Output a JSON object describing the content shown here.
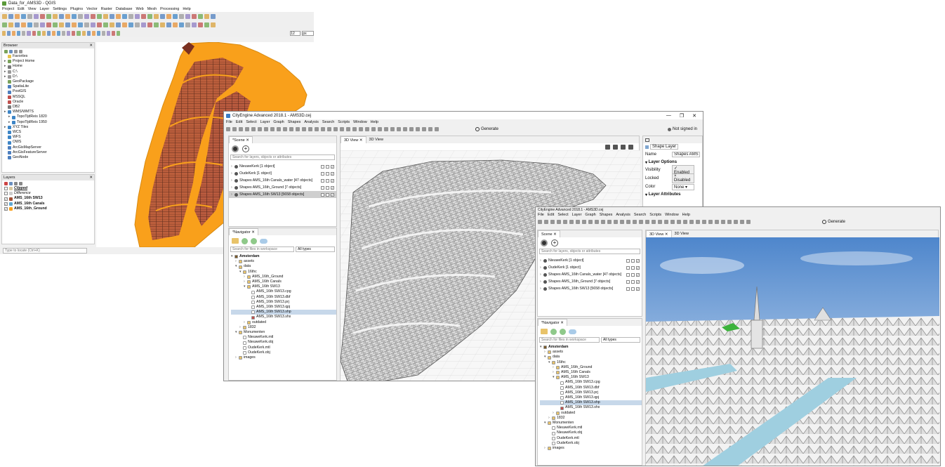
{
  "qgis": {
    "title": "Data_for_AMS3D - QGIS",
    "menu": [
      "Project",
      "Edit",
      "View",
      "Layer",
      "Settings",
      "Plugins",
      "Vector",
      "Raster",
      "Database",
      "Web",
      "Mesh",
      "Processing",
      "Help"
    ],
    "scale_value": "12",
    "unit_value": "px",
    "browser": {
      "title": "Browser",
      "items": [
        "Favorites",
        "Project Home",
        "Home",
        "C:\\",
        "D:\\",
        "GeoPackage",
        "SpatiaLite",
        "PostGIS",
        "MSSQL",
        "Oracle",
        "DB2",
        "WMS/WMTS",
        "TopoTijdReis 1820",
        "TopoTijdReis 1950",
        "XYZ Tiles",
        "WCS",
        "WFS",
        "OWS",
        "ArcGisMapServer",
        "ArcGisFeatureServer",
        "GeoNode"
      ]
    },
    "layers": {
      "title": "Layers",
      "items": [
        "Clipped",
        "Difference",
        "AMS_16th SW13",
        "AMS_16th Canals",
        "AMS_16th_Ground"
      ]
    },
    "locator_placeholder": "Type to locate (Ctrl+K)"
  },
  "ce1": {
    "title": "CityEngine Advanced 2018.1 - AMS3D.cej",
    "menu": [
      "File",
      "Edit",
      "Select",
      "Layer",
      "Graph",
      "Shapes",
      "Analysis",
      "Search",
      "Scripts",
      "Window",
      "Help"
    ],
    "generate_label": "Generate",
    "not_signed_in": "Not signed in",
    "scene": {
      "tab": "*Scene",
      "search_placeholder": "Search for layers, objects or attributes",
      "rows": [
        "NieuweKerk [1 object]",
        "OudeKerk [1 object]",
        "Shapes AMS_16th Canals_water [47 objects]",
        "Shapes AMS_16th_Ground [7 objects]",
        "Shapes AMS_16th SW13 [5658 objects]"
      ]
    },
    "navigator": {
      "tab": "*Navigator",
      "search_placeholder": "Search for files in workspace",
      "filter": "All types",
      "tree": [
        "Amsterdam",
        "assets",
        "data",
        "16thc",
        "AMS_16th_Ground",
        "AMS_16th Canals",
        "AMS_16th SW13",
        "AMS_16th SW13.cpg",
        "AMS_16th SW13.dbf",
        "AMS_16th SW13.prj",
        "AMS_16th SW13.qpj",
        "AMS_16th SW13.shp",
        "AMS_16th SW13.shx",
        "outdated",
        "1832",
        "Monumenten",
        "NieuweKerk.mtl",
        "NieuweKerk.obj",
        "OudeKerk.mtl",
        "OudeKerk.obj",
        "images"
      ]
    },
    "view_tabs": [
      "3D View",
      "3D View"
    ],
    "inspector": {
      "tab": "Shape Layer",
      "name_label": "Name",
      "name_value": "Shapes AMS",
      "options_header": "Layer Options",
      "visibility_label": "Visibility",
      "visibility_value": "Enabled",
      "locked_label": "Locked",
      "locked_value": "Disabled",
      "color_label": "Color",
      "color_value": "None",
      "attributes_header": "Layer Attributes"
    }
  },
  "ce2": {
    "title": "CityEngine Advanced 2018.1 - AMS3D.cej",
    "menu": [
      "File",
      "Edit",
      "Select",
      "Layer",
      "Graph",
      "Shapes",
      "Analysis",
      "Search",
      "Scripts",
      "Window",
      "Help"
    ],
    "generate_label": "Generate",
    "scene_tab": "Scene",
    "navigator_tab": "*Navigator",
    "view_tabs": [
      "3D View",
      "3D View"
    ]
  },
  "colors": {
    "orange": "#f9a01b",
    "parcel": "#b85a3e",
    "water": "#9fcfe0",
    "sky": "#7aa6d8"
  }
}
